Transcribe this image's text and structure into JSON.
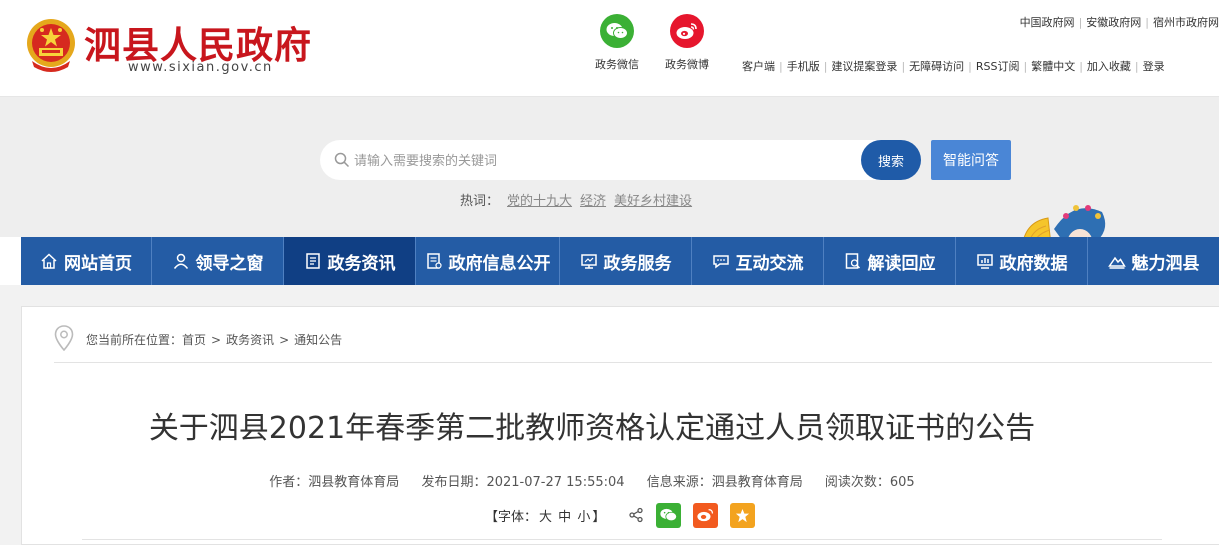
{
  "header": {
    "site_name": "泗县人民政府",
    "site_url": "www.sixian.gov.cn",
    "social": [
      {
        "label": "政务微信",
        "icon": "wechat-icon",
        "color": "#3bb035"
      },
      {
        "label": "政务微博",
        "icon": "weibo-icon",
        "color": "#e6162d"
      }
    ],
    "top_links": [
      "中国政府网",
      "安徽政府网",
      "宿州市政府网"
    ],
    "tools": [
      "客户端",
      "手机版",
      "建议提案登录",
      "无障碍访问",
      "RSS订阅",
      "繁體中文",
      "加入收藏",
      "登录"
    ]
  },
  "search": {
    "placeholder": "请输入需要搜索的关键词",
    "button": "搜索",
    "qa_button": "智能问答",
    "hot_label": "热词：",
    "hot_words": [
      "党的十九大",
      "经济",
      "美好乡村建设"
    ]
  },
  "nav": {
    "items": [
      {
        "label": "网站首页",
        "icon": "home-icon"
      },
      {
        "label": "领导之窗",
        "icon": "user-icon"
      },
      {
        "label": "政务资讯",
        "icon": "document-icon",
        "active": true
      },
      {
        "label": "政府信息公开",
        "icon": "list-icon"
      },
      {
        "label": "政务服务",
        "icon": "monitor-icon"
      },
      {
        "label": "互动交流",
        "icon": "chat-icon"
      },
      {
        "label": "解读回应",
        "icon": "search-doc-icon"
      },
      {
        "label": "政府数据",
        "icon": "chart-icon"
      },
      {
        "label": "魅力泗县",
        "icon": "mountain-icon"
      }
    ],
    "active_color": "#103f84",
    "bar_color": "#245ca5"
  },
  "breadcrumb": {
    "prefix": "您当前所在位置：",
    "items": [
      "首页",
      "政务资讯",
      "通知公告"
    ]
  },
  "article": {
    "title": "关于泗县2021年春季第二批教师资格认定通过人员领取证书的公告",
    "author_label": "作者：",
    "author": "泗县教育体育局",
    "date_label": "发布日期：",
    "date": "2021-07-27 15:55:04",
    "source_label": "信息来源：",
    "source": "泗县教育体育局",
    "views_label": "阅读次数：",
    "views": "605",
    "font_label": "【字体：",
    "font_sizes": [
      "大",
      "中",
      "小"
    ],
    "font_close": "】"
  }
}
